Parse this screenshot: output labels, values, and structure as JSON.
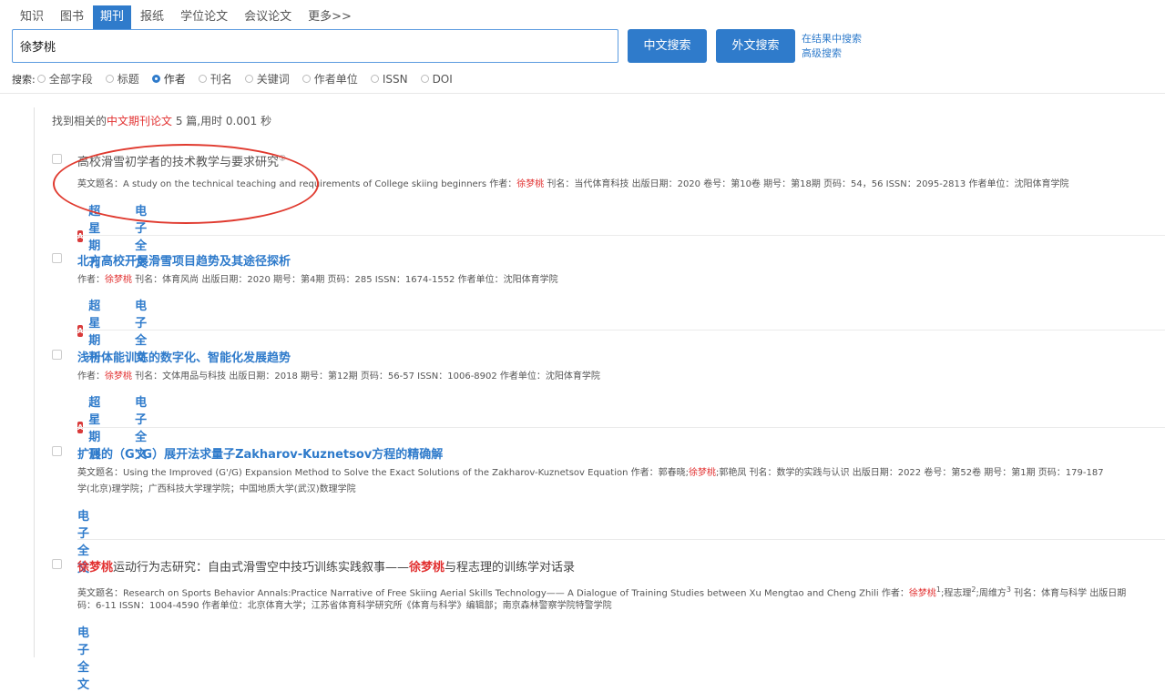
{
  "tabs": [
    "知识",
    "图书",
    "期刊",
    "报纸",
    "学位论文",
    "会议论文",
    "更多>>"
  ],
  "active_tab": 2,
  "search": {
    "value": "徐梦桃",
    "btn_cn": "中文搜索",
    "btn_foreign": "外文搜索",
    "link_within": "在结果中搜索",
    "link_advanced": "高级搜索"
  },
  "fields": {
    "label": "搜索:",
    "options": [
      "全部字段",
      "标题",
      "作者",
      "刊名",
      "关键词",
      "作者单位",
      "ISSN",
      "DOI"
    ],
    "selected": 2
  },
  "summary": {
    "pre": "找到相关的",
    "hl": "中文期刊论文",
    "post": " 5 篇,用时 0.001 秒"
  },
  "actions": {
    "superstar": "超星期刊",
    "fulltext": "电子全文"
  },
  "results": [
    {
      "title": "高校滑雪初学者的技术教学与要求研究",
      "mark": "①",
      "meta_pre": "英文题名：A study on the technical teaching and requirements of College skiing beginners  作者：",
      "author": "徐梦桃",
      "meta_post": "  刊名：当代体育科技  出版日期：2020  卷号：第10卷  期号：第18期  页码：54，56  ISSN：2095-2813  作者单位：沈阳体育学院"
    },
    {
      "title": "北方高校开展滑雪项目趋势及其途径探析",
      "meta_pre": "作者：",
      "author": "徐梦桃",
      "meta_post": "  刊名：体育风尚  出版日期：2020  期号：第4期  页码：285  ISSN：1674-1552  作者单位：沈阳体育学院"
    },
    {
      "title": "浅析体能训练的数字化、智能化发展趋势",
      "meta_pre": "作者：",
      "author": "徐梦桃",
      "meta_post": "  刊名：文体用品与科技  出版日期：2018  期号：第12期  页码：56-57  ISSN：1006-8902  作者单位：沈阳体育学院"
    },
    {
      "title": "扩展的（G'/G）展开法求量子Zakharov-Kuznetsov方程的精确解",
      "meta_pre": "英文题名：Using the Improved (G'/G) Expansion Method to Solve the Exact Solutions of the Zakharov-Kuznetsov Equation  作者：郭春晓;",
      "author": "徐梦桃",
      "meta_post": ";郭艳凤  刊名：数学的实践与认识  出版日期：2022  卷号：第52卷  期号：第1期  页码：179-187",
      "meta_line2": "学(北京)理学院；广西科技大学理学院；中国地质大学(武汉)数理学院"
    },
    {
      "title_hl1": "徐梦桃",
      "title_mid": "运动行为志研究：自由式滑雪空中技巧训练实践叙事——",
      "title_hl2": "徐梦桃",
      "title_end": "与程志理的训练学对话录",
      "meta_pre": "英文题名：Research on Sports Behavior Annals:Practice Narrative of Free Skiing Aerial Skills Technology—— A Dialogue of Training Studies between Xu Mengtao and Cheng Zhili  作者：",
      "author": "徐梦桃",
      "sup1": "1",
      "co1": ";程志理",
      "sup2": "2",
      "co2": ";周维方",
      "sup3": "3",
      "meta_post": "  刊名：体育与科学  出版日期",
      "meta_line2": "码：6-11  ISSN：1004-4590  作者单位：北京体育大学；江苏省体育科学研究所《体育与科学》编辑部；南京森林警察学院特警学院"
    }
  ]
}
